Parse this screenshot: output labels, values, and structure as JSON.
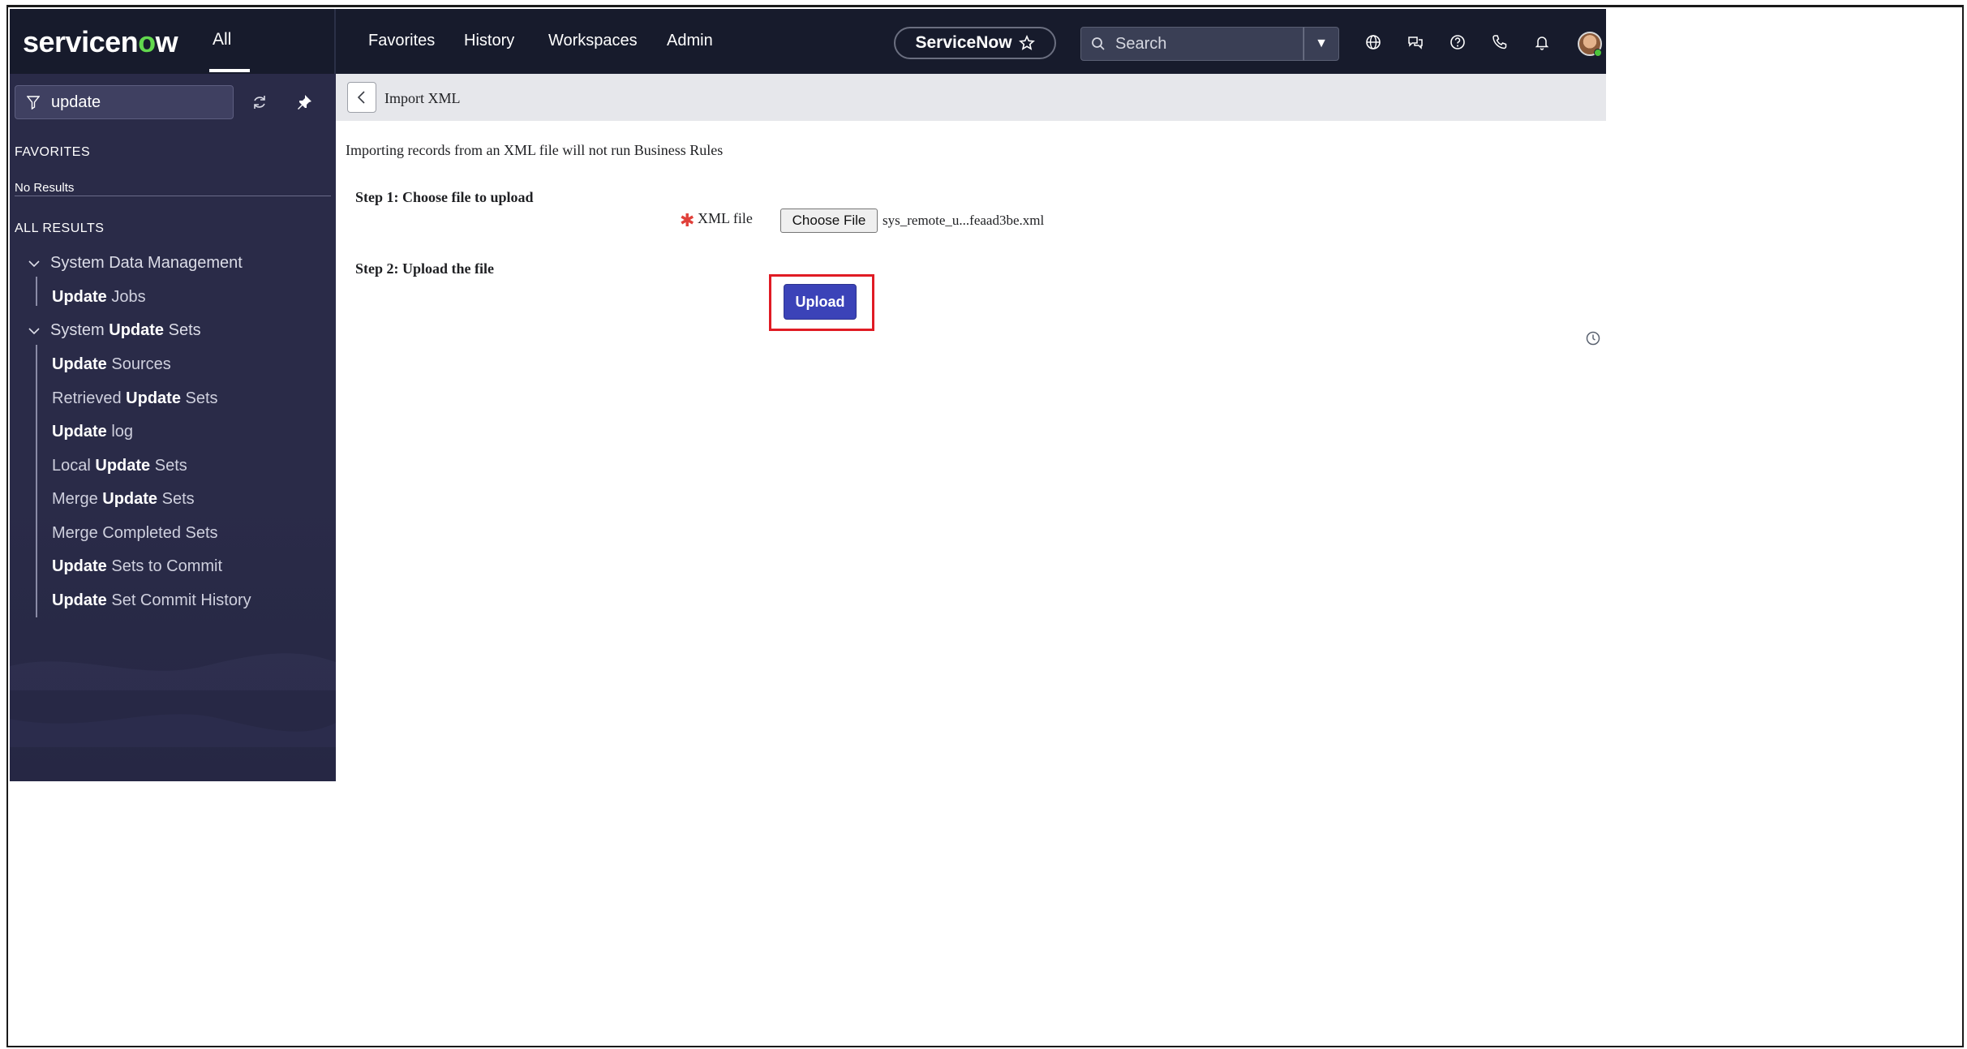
{
  "app": {
    "logo_text_a": "servicen",
    "logo_text_o": "o",
    "logo_text_b": "w",
    "all_tab": "All",
    "nav": [
      "Favorites",
      "History",
      "Workspaces",
      "Admin"
    ],
    "instance": "ServiceNow",
    "search_placeholder": "Search"
  },
  "sidebar": {
    "filter_value": "update",
    "favorites_heading": "FAVORITES",
    "no_results": "No Results",
    "all_results_heading": "ALL RESULTS",
    "groups": [
      {
        "label": "System Data Management"
      },
      {
        "label_pre": "System ",
        "label_bold": "Update",
        "label_post": " Sets"
      }
    ],
    "items": [
      {
        "pre": "",
        "bold": "Update",
        "post": " Jobs"
      },
      {
        "pre": "",
        "bold": "Update",
        "post": " Sources"
      },
      {
        "pre": "Retrieved ",
        "bold": "Update",
        "post": " Sets"
      },
      {
        "pre": "",
        "bold": "Update",
        "post": " log"
      },
      {
        "pre": "Local ",
        "bold": "Update",
        "post": " Sets"
      },
      {
        "pre": "Merge ",
        "bold": "Update",
        "post": " Sets"
      },
      {
        "pre": "Merge Completed Sets",
        "bold": "",
        "post": ""
      },
      {
        "pre": "",
        "bold": "Update",
        "post": " Sets to Commit"
      },
      {
        "pre": "",
        "bold": "Update",
        "post": " Set Commit History"
      }
    ]
  },
  "content": {
    "title": "Import XML",
    "notice": "Importing records from an XML file will not run Business Rules",
    "step1": "Step 1: Choose file to upload",
    "xml_label": "XML file",
    "choose_button": "Choose File",
    "file_name": "sys_remote_u...feaad3be.xml",
    "step2": "Step 2: Upload the file",
    "upload_button": "Upload"
  },
  "colors": {
    "nav_bg": "#171b2c",
    "sidebar_bg": "#2a2b48",
    "accent_green": "#62d84e",
    "upload_bg": "#3b43b8",
    "highlight_red": "#e01b24"
  }
}
